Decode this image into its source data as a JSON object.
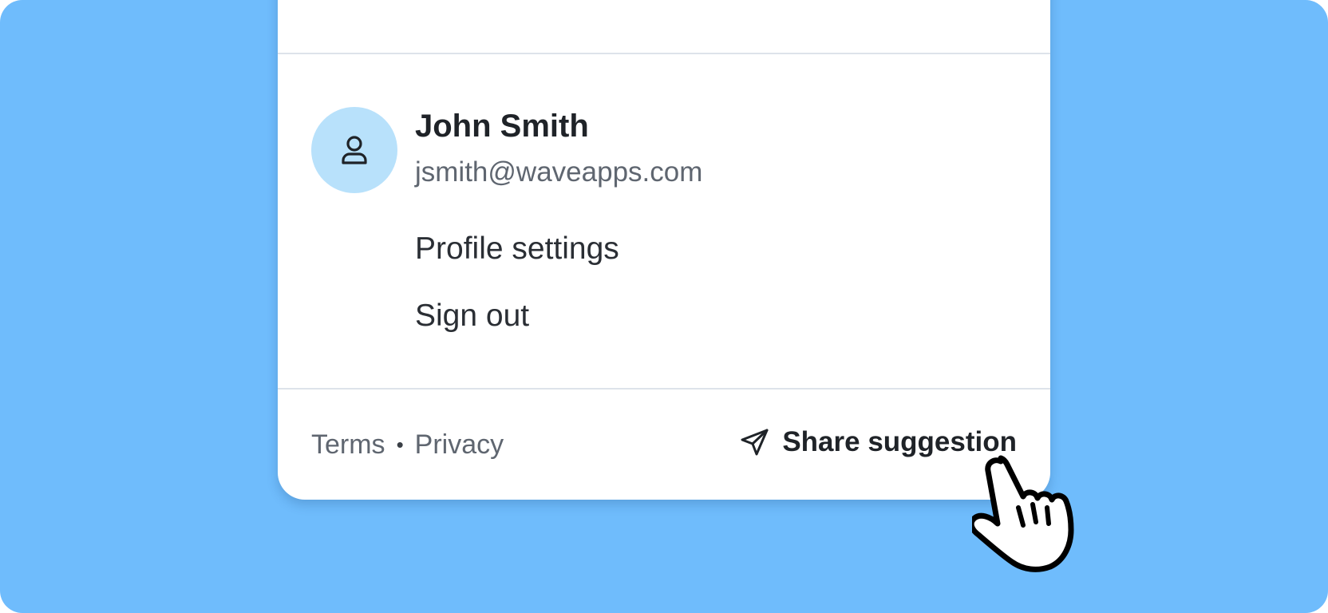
{
  "user": {
    "name": "John Smith",
    "email": "jsmith@waveapps.com",
    "avatar_icon": "user-icon"
  },
  "menu": {
    "items": [
      {
        "label": "Profile settings"
      },
      {
        "label": "Sign out"
      }
    ]
  },
  "footer": {
    "terms_label": "Terms",
    "separator": "•",
    "privacy_label": "Privacy",
    "share_label": "Share suggestion",
    "share_icon": "paper-plane-icon"
  },
  "cursor": {
    "icon": "pointer-hand-icon"
  },
  "colors": {
    "background": "#6fbcfc",
    "panel": "#ffffff",
    "avatar_bg": "#b8e1fb",
    "text_primary": "#1f2328",
    "text_secondary": "#5f6670"
  }
}
